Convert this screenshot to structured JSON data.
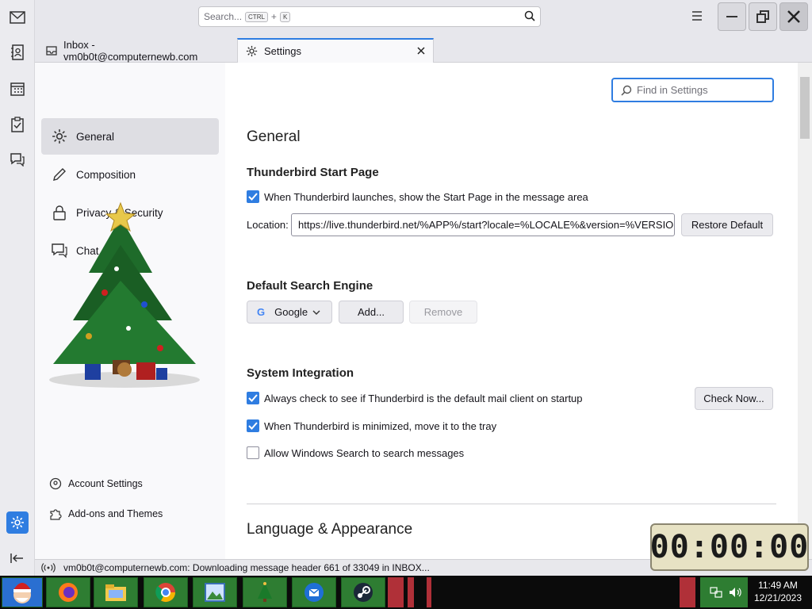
{
  "topbar": {
    "search_placeholder": "Search...",
    "shortcut_ctrl": "CTRL",
    "shortcut_plus": "+",
    "shortcut_key": "K"
  },
  "tabs": [
    {
      "label": "Inbox - vm0b0t@computernewb.com"
    },
    {
      "label": "Settings"
    }
  ],
  "nav": {
    "items": [
      {
        "label": "General"
      },
      {
        "label": "Composition"
      },
      {
        "label": "Privacy & Security"
      },
      {
        "label": "Chat"
      }
    ],
    "footer": [
      {
        "label": "Account Settings"
      },
      {
        "label": "Add-ons and Themes"
      }
    ]
  },
  "settings": {
    "find_placeholder": "Find in Settings",
    "heading": "General",
    "start_page": {
      "title": "Thunderbird Start Page",
      "checkbox": "When Thunderbird launches, show the Start Page in the message area",
      "location_label": "Location:",
      "location_value": "https://live.thunderbird.net/%APP%/start?locale=%LOCALE%&version=%VERSIO",
      "restore_button": "Restore Default"
    },
    "search_engine": {
      "title": "Default Search Engine",
      "selected": "Google",
      "add_button": "Add...",
      "remove_button": "Remove"
    },
    "system_integration": {
      "title": "System Integration",
      "default_client": "Always check to see if Thunderbird is the default mail client on startup",
      "check_now_button": "Check Now...",
      "tray": "When Thunderbird is minimized, move it to the tray",
      "windows_search": "Allow Windows Search to search messages"
    },
    "language_heading": "Language & Appearance"
  },
  "status": {
    "text": "vm0b0t@computernewb.com: Downloading message header 661 of 33049 in INBOX..."
  },
  "timer": {
    "display": "00:00:00"
  },
  "taskbar": {
    "time": "11:49 AM",
    "date": "12/21/2023"
  },
  "colors": {
    "accent": "#2f7de1",
    "taskbar_green": "#2e7d32",
    "taskbar_red": "#b03038"
  }
}
